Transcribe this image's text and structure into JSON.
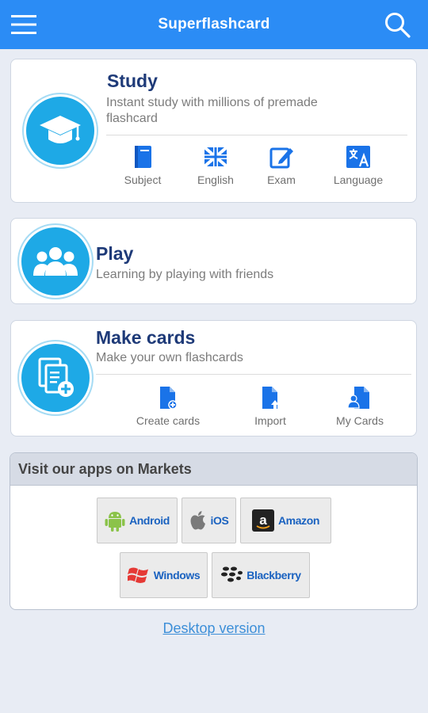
{
  "header": {
    "title": "Superflashcard",
    "menu_icon": "hamburger-menu-icon",
    "search_icon": "search-icon",
    "color": "#2b8cf5"
  },
  "study": {
    "title": "Study",
    "desc_line1": "Instant study with millions of premade",
    "desc_line2": "flashcard",
    "icon": "graduation-cap-icon",
    "items": [
      {
        "label": "Subject",
        "icon": "book-icon"
      },
      {
        "label": "English",
        "icon": "uk-flag-icon"
      },
      {
        "label": "Exam",
        "icon": "edit-icon"
      },
      {
        "label": "Language",
        "icon": "translate-icon"
      }
    ]
  },
  "play": {
    "title": "Play",
    "desc": "Learning by playing with friends",
    "icon": "group-icon"
  },
  "make_cards": {
    "title": "Make cards",
    "desc": "Make your own flashcards",
    "icon": "add-document-icon",
    "items": [
      {
        "label": "Create cards",
        "icon": "create-document-icon"
      },
      {
        "label": "Import",
        "icon": "import-document-icon"
      },
      {
        "label": "My Cards",
        "icon": "my-cards-icon"
      }
    ]
  },
  "markets": {
    "heading": "Visit our apps on Markets",
    "buttons": [
      {
        "label": "Android",
        "icon": "android-icon"
      },
      {
        "label": "iOS",
        "icon": "apple-icon"
      },
      {
        "label": "Amazon",
        "icon": "amazon-icon"
      },
      {
        "label": "Windows",
        "icon": "windows-icon"
      },
      {
        "label": "Blackberry",
        "icon": "blackberry-icon"
      }
    ]
  },
  "footer": {
    "desktop_link": "Desktop version"
  },
  "colors": {
    "accent": "#1ea9e6",
    "title": "#1e3a78",
    "link": "#3d8fd8",
    "icon_blue": "#1a73e8"
  }
}
